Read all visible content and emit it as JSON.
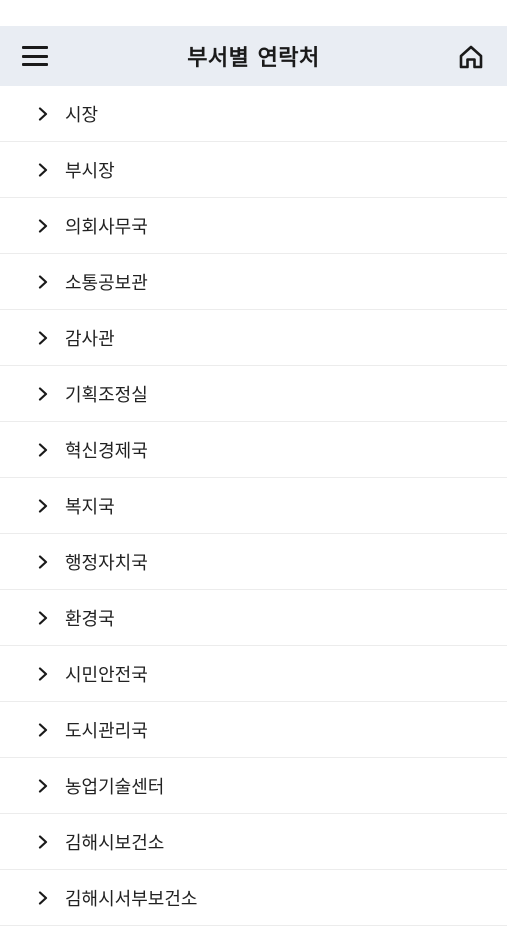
{
  "header": {
    "title": "부서별 연락처",
    "menu_icon": "menu-icon",
    "home_icon": "home-icon"
  },
  "departments": [
    {
      "label": "시장"
    },
    {
      "label": "부시장"
    },
    {
      "label": "의회사무국"
    },
    {
      "label": "소통공보관"
    },
    {
      "label": "감사관"
    },
    {
      "label": "기획조정실"
    },
    {
      "label": "혁신경제국"
    },
    {
      "label": "복지국"
    },
    {
      "label": "행정자치국"
    },
    {
      "label": "환경국"
    },
    {
      "label": "시민안전국"
    },
    {
      "label": "도시관리국"
    },
    {
      "label": "농업기술센터"
    },
    {
      "label": "김해시보건소"
    },
    {
      "label": "김해시서부보건소"
    }
  ],
  "colors": {
    "header_bg": "#e9edf3",
    "divider": "#ececec",
    "text": "#1a1a1a"
  }
}
